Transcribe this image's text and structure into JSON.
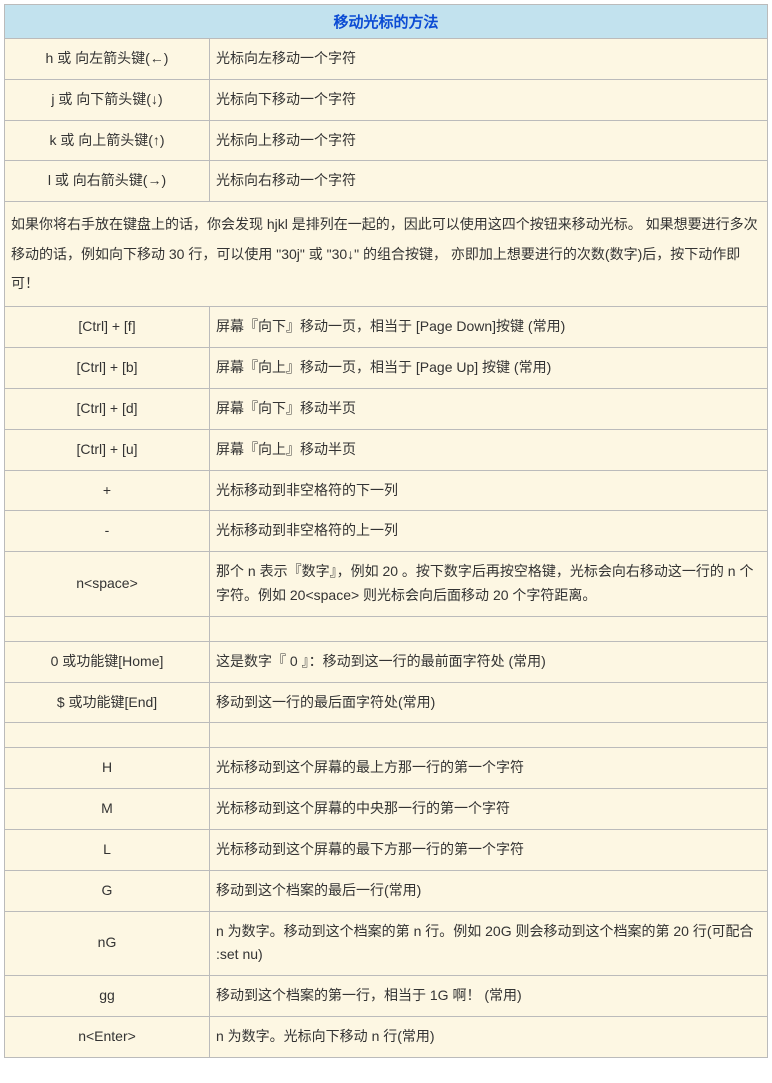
{
  "header": "移动光标的方法",
  "rows1": [
    {
      "key": "h 或 向左箭头键(←)",
      "desc": "光标向左移动一个字符"
    },
    {
      "key": "j 或 向下箭头键(↓)",
      "desc": "光标向下移动一个字符"
    },
    {
      "key": "k 或 向上箭头键(↑)",
      "desc": "光标向上移动一个字符"
    },
    {
      "key": "l 或 向右箭头键(→)",
      "desc": "光标向右移动一个字符"
    }
  ],
  "note1": "如果你将右手放在键盘上的话，你会发现 hjkl 是排列在一起的，因此可以使用这四个按钮来移动光标。 如果想要进行多次移动的话，例如向下移动 30 行，可以使用 \"30j\" 或 \"30↓\" 的组合按键， 亦即加上想要进行的次数(数字)后，按下动作即可！",
  "rows2": [
    {
      "key": "[Ctrl] + [f]",
      "desc": "屏幕『向下』移动一页，相当于 [Page Down]按键 (常用)"
    },
    {
      "key": "[Ctrl] + [b]",
      "desc": "屏幕『向上』移动一页，相当于 [Page Up] 按键 (常用)"
    },
    {
      "key": "[Ctrl] + [d]",
      "desc": "屏幕『向下』移动半页"
    },
    {
      "key": "[Ctrl] + [u]",
      "desc": "屏幕『向上』移动半页"
    },
    {
      "key": "+",
      "desc": "光标移动到非空格符的下一列"
    },
    {
      "key": "-",
      "desc": "光标移动到非空格符的上一列"
    },
    {
      "key": "n<space>",
      "desc": "那个 n 表示『数字』，例如 20 。按下数字后再按空格键，光标会向右移动这一行的 n 个字符。例如 20<space> 则光标会向后面移动 20 个字符距离。"
    }
  ],
  "rows3": [
    {
      "key": "0 或功能键[Home]",
      "desc": "这是数字『 0 』：移动到这一行的最前面字符处 (常用)"
    },
    {
      "key": "$ 或功能键[End]",
      "desc": "移动到这一行的最后面字符处(常用)"
    }
  ],
  "rows4": [
    {
      "key": "H",
      "desc": "光标移动到这个屏幕的最上方那一行的第一个字符"
    },
    {
      "key": "M",
      "desc": "光标移动到这个屏幕的中央那一行的第一个字符"
    },
    {
      "key": "L",
      "desc": "光标移动到这个屏幕的最下方那一行的第一个字符"
    },
    {
      "key": "G",
      "desc": "移动到这个档案的最后一行(常用)"
    },
    {
      "key": "nG",
      "desc": "n 为数字。移动到这个档案的第 n 行。例如 20G 则会移动到这个档案的第 20 行(可配合 :set nu)"
    },
    {
      "key": "gg",
      "desc": "移动到这个档案的第一行，相当于 1G 啊！ (常用)"
    },
    {
      "key": "n<Enter>",
      "desc": "n 为数字。光标向下移动 n 行(常用)"
    }
  ]
}
